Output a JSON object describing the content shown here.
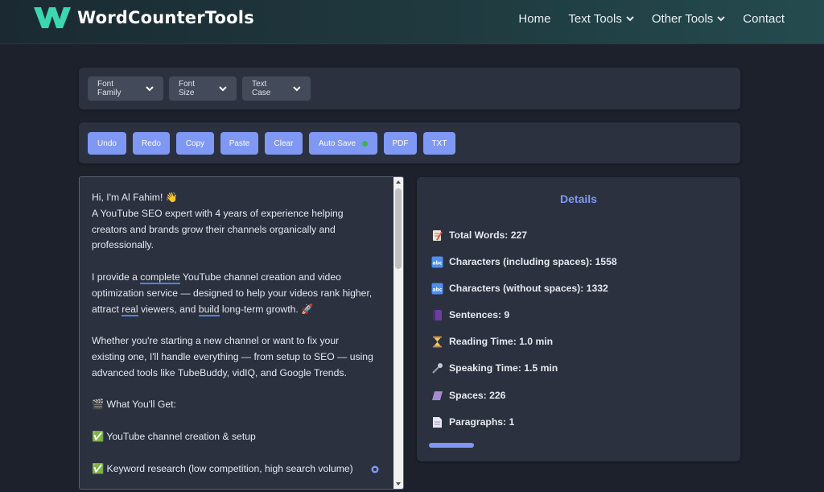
{
  "header": {
    "brand": "WordCounterTools",
    "nav": [
      {
        "label": "Home"
      },
      {
        "label": "Text Tools"
      },
      {
        "label": "Other Tools"
      },
      {
        "label": "Contact"
      }
    ]
  },
  "font_toolbar": {
    "font_family": "Font Family",
    "font_size": "Font Size",
    "text_case": "Text Case"
  },
  "action_toolbar": {
    "undo": "Undo",
    "redo": "Redo",
    "copy": "Copy",
    "paste": "Paste",
    "clear": "Clear",
    "auto_save": "Auto Save",
    "pdf": "PDF",
    "txt": "TXT"
  },
  "editor": {
    "p1_l1": "Hi, I'm Al Fahim! 👋",
    "p1_l2": "A YouTube SEO expert with 4 years of experience helping",
    "p1_l3": "creators and brands grow their channels organically and",
    "p1_l4": "professionally.",
    "p2_a": "I provide a ",
    "p2_u1": "complete",
    "p2_b": " YouTube channel creation and video",
    "p2_l2": "optimization service — designed to help your videos rank higher,",
    "p2_c": "attract ",
    "p2_u2": "real",
    "p2_d": " viewers, and ",
    "p2_u3": "build",
    "p2_e": " long-term growth. 🚀",
    "p3_l1": "Whether you're starting a new channel or want to fix your",
    "p3_l2": "existing one, I'll handle everything — from setup to SEO — using",
    "p3_l3": "advanced tools like TubeBuddy, vidIQ, and Google Trends.",
    "p4": "🎬 What You'll Get:",
    "p5": "✅ YouTube channel creation & setup",
    "p6": "✅ Keyword research (low competition, high search volume)"
  },
  "details": {
    "title": "Details",
    "stats": [
      {
        "label": "Total Words: 227",
        "icon": "memo-icon"
      },
      {
        "label": "Characters (including spaces): 1558",
        "icon": "abc-icon"
      },
      {
        "label": "Characters (without spaces): 1332",
        "icon": "abc-icon"
      },
      {
        "label": "Sentences: 9",
        "icon": "book-icon"
      },
      {
        "label": "Reading Time: 1.0 min",
        "icon": "hourglass-icon"
      },
      {
        "label": "Speaking Time: 1.5 min",
        "icon": "microphone-icon"
      },
      {
        "label": "Spaces: 226",
        "icon": "space-icon"
      },
      {
        "label": "Paragraphs: 1",
        "icon": "page-icon"
      }
    ],
    "progress_fraction": 0.15
  },
  "colors": {
    "accent": "#7f98f4",
    "autosave_dot": "#3bb54a",
    "logo": "#3cd6b0"
  }
}
